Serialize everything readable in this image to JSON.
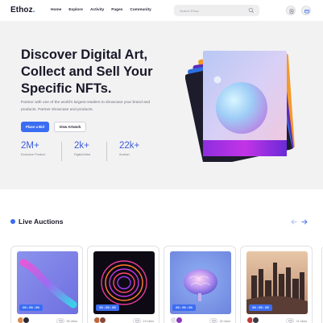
{
  "header": {
    "logo_text": "Ethoz",
    "logo_dot": ".",
    "nav": [
      "Home",
      "Explore",
      "Activity",
      "Pages",
      "Community"
    ],
    "search_placeholder": "Search Ethoz",
    "icons": [
      "search-icon",
      "document-icon",
      "wallet-icon"
    ]
  },
  "hero": {
    "title_lines": [
      "Discover Digital Art,",
      "Collect and Sell Your",
      "Specific NFTs."
    ],
    "description": "Partner with one of the world's largest retailers to showcase your brand and products. Partner showcase and products.",
    "primary_button": "Place a Bid",
    "secondary_button": "View Artwork",
    "stats": [
      {
        "value": "2M+",
        "label": "Exclusive Product"
      },
      {
        "value": "2k+",
        "label": "Digital Artist"
      },
      {
        "value": "22k+",
        "label": "Auction"
      }
    ]
  },
  "auctions": {
    "title": "Live Auctions",
    "cards": [
      {
        "timer": "00 : 00 : 00",
        "likes": "50 Likes"
      },
      {
        "timer": "00 : 00 : 00",
        "likes": "19 Likes"
      },
      {
        "timer": "00 : 00 : 00",
        "likes": "20 Likes"
      },
      {
        "timer": "00 : 00 : 00",
        "likes": "11 Likes"
      }
    ]
  },
  "colors": {
    "accent": "#3b6df2",
    "hero_bg": "#f2f2f3",
    "stat_number": "#3b5bd8",
    "title_text": "#181828"
  }
}
